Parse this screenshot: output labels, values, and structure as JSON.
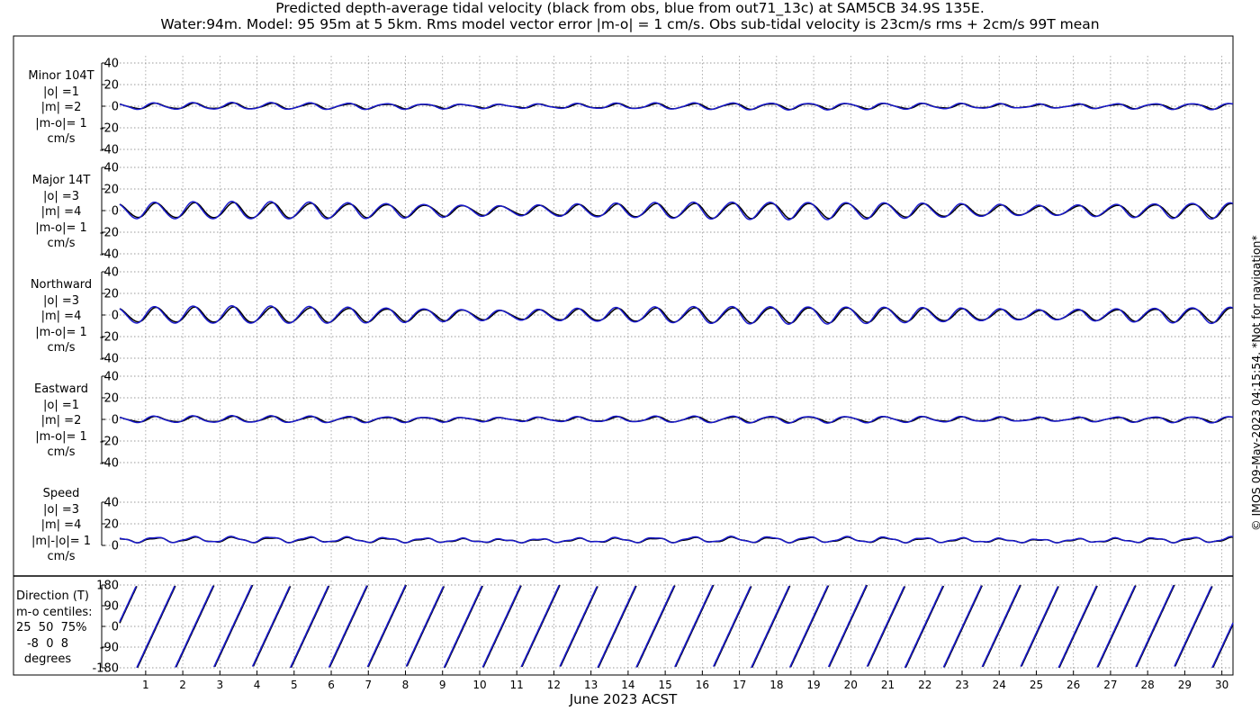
{
  "title": {
    "line1": "Predicted depth-average tidal velocity (black from obs, blue from out71_13c) at SAM5CB 34.9S 135E.",
    "line2": "Water:94m. Model: 95 95m at 5 5km. Rms model vector error |m-o| = 1 cm/s. Obs sub-tidal velocity is 23cm/s rms + 2cm/s 99T mean"
  },
  "copyright": "© IMOS 09-May-2023 04:15:54.  *Not for navigation*",
  "xlabel": "June 2023 ACST",
  "colors": {
    "obs": "#000000",
    "model": "#1a1acc"
  },
  "panels": [
    {
      "label": [
        "Minor 104T",
        "|o| =1",
        "|m| =2",
        "|m-o|= 1",
        "cm/s"
      ]
    },
    {
      "label": [
        "Major 14T",
        "|o| =3",
        "|m| =4",
        "|m-o|= 1",
        "cm/s"
      ]
    },
    {
      "label": [
        "Northward",
        "|o| =3",
        "|m| =4",
        "|m-o|= 1",
        "cm/s"
      ]
    },
    {
      "label": [
        "Eastward",
        "|o| =1",
        "|m| =2",
        "|m-o|= 1",
        "cm/s"
      ]
    },
    {
      "label": [
        "Speed",
        "|o| =3",
        "|m| =4",
        "|m|-|o|= 1",
        "cm/s"
      ]
    },
    {
      "label": [
        "Direction (T)",
        "m-o centiles:",
        "25  50  75%",
        "-8  0  8",
        "degrees"
      ]
    }
  ],
  "chart_data": [
    {
      "type": "line",
      "panel": "Minor 104T",
      "x_range": [
        0.3,
        30.3
      ],
      "ylim": [
        -40,
        40
      ],
      "yticks": [
        -40,
        -20,
        0,
        20,
        40
      ],
      "grid": true,
      "series": [
        {
          "amplitude_cm_s": 2.5,
          "mean": 0
        },
        {
          "amplitude_cm_s": 3.0,
          "mean": 0
        }
      ]
    },
    {
      "type": "line",
      "panel": "Major 14T",
      "x_range": [
        0.3,
        30.3
      ],
      "ylim": [
        -40,
        40
      ],
      "yticks": [
        -40,
        -20,
        0,
        20,
        40
      ],
      "grid": true,
      "series": [
        {
          "amplitude_cm_s": 7,
          "mean": 0
        },
        {
          "amplitude_cm_s": 8,
          "mean": 0
        }
      ]
    },
    {
      "type": "line",
      "panel": "Northward",
      "x_range": [
        0.3,
        30.3
      ],
      "ylim": [
        -40,
        40
      ],
      "yticks": [
        -40,
        -20,
        0,
        20,
        40
      ],
      "grid": true,
      "series": [
        {
          "amplitude_cm_s": 7,
          "mean": 0
        },
        {
          "amplitude_cm_s": 8,
          "mean": 0
        }
      ]
    },
    {
      "type": "line",
      "panel": "Eastward",
      "x_range": [
        0.3,
        30.3
      ],
      "ylim": [
        -40,
        40
      ],
      "yticks": [
        -40,
        -20,
        0,
        20,
        40
      ],
      "grid": true,
      "series": [
        {
          "amplitude_cm_s": 2.5,
          "mean": 0
        },
        {
          "amplitude_cm_s": 3.0,
          "mean": 0
        }
      ]
    },
    {
      "type": "line",
      "panel": "Speed",
      "x_range": [
        0.3,
        30.3
      ],
      "ylim": [
        0,
        40
      ],
      "yticks": [
        0,
        20,
        40
      ],
      "grid": true,
      "series": [
        {
          "amplitude_cm_s": 6,
          "mean": 3
        },
        {
          "amplitude_cm_s": 7,
          "mean": 3
        }
      ]
    },
    {
      "type": "line",
      "panel": "Direction (T)",
      "x_range": [
        0.3,
        30.3
      ],
      "ylim": [
        -180,
        180
      ],
      "yticks": [
        -180,
        -90,
        0,
        90,
        180
      ],
      "grid": true,
      "series": [
        {
          "range_deg": [
            -180,
            180
          ]
        },
        {
          "range_deg": [
            -180,
            180
          ]
        }
      ]
    }
  ],
  "xticks": [
    "1",
    "2",
    "3",
    "4",
    "5",
    "6",
    "7",
    "8",
    "9",
    "10",
    "11",
    "12",
    "13",
    "14",
    "15",
    "16",
    "17",
    "18",
    "19",
    "20",
    "21",
    "22",
    "23",
    "24",
    "25",
    "26",
    "27",
    "28",
    "29",
    "30"
  ]
}
